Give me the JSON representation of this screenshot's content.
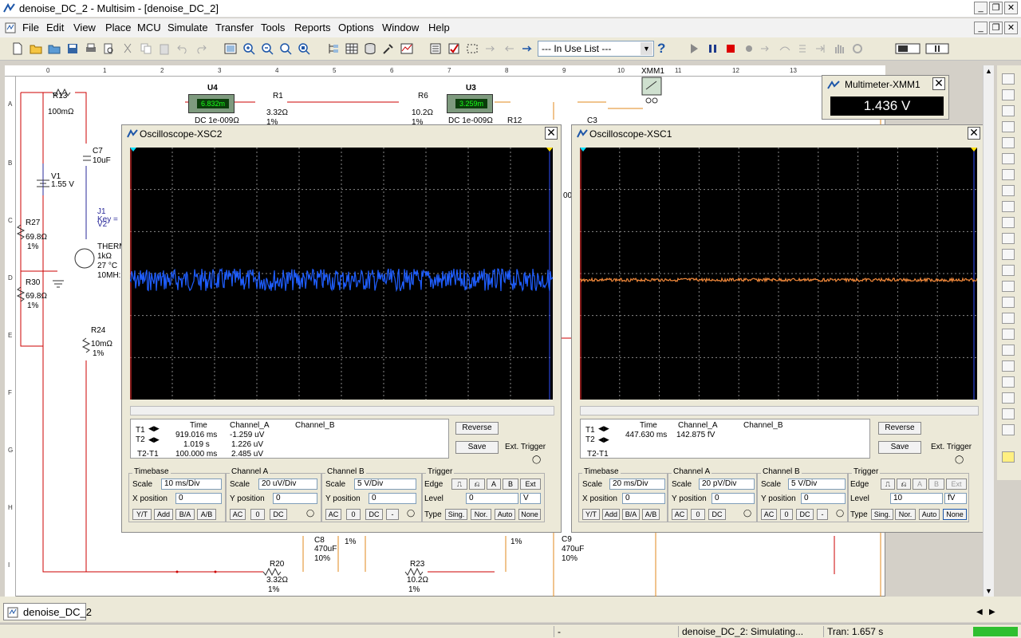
{
  "window": {
    "title": "denoise_DC_2 - Multisim - [denoise_DC_2]"
  },
  "menu": [
    "File",
    "Edit",
    "View",
    "Place",
    "MCU",
    "Simulate",
    "Transfer",
    "Tools",
    "Reports",
    "Options",
    "Window",
    "Help"
  ],
  "toolbar": {
    "in_use_list": "--- In Use List ---",
    "help": "?"
  },
  "ruler": {
    "top": [
      "0",
      "1",
      "2",
      "3",
      "4",
      "5",
      "6",
      "7",
      "8",
      "9",
      "10",
      "11",
      "12",
      "13"
    ],
    "left": [
      "A",
      "B",
      "C",
      "D",
      "E",
      "F",
      "G",
      "H",
      "I"
    ]
  },
  "schematic": {
    "R13": "R13",
    "R13v": "100mΩ",
    "U4": "U4",
    "U4_disp": "6.832m",
    "U4_mode": "DC  1e-009Ω",
    "R1": "R1",
    "R1v": "3.32Ω",
    "R1t": "1%",
    "R6": "R6",
    "R6v": "10.2Ω",
    "R6t": "1%",
    "U3": "U3",
    "U3_disp": "3.259m",
    "U3_mode": "DC  1e-009Ω",
    "R12": "R12",
    "C3": "C3",
    "C7": "C7",
    "C7v": "10uF",
    "V1": "V1",
    "V1v": "1.55 V",
    "J1": "J1",
    "J1k": "Key =",
    "J1v": "V2",
    "R27": "R27",
    "R27v": "69.8Ω",
    "R27t": "1%",
    "THERM": "THERM",
    "THv": "1kΩ",
    "THt": "27 °C",
    "THf": "10MH:",
    "R30": "R30",
    "R30v": "69.8Ω",
    "R30t": "1%",
    "R24": "R24",
    "R24v": "10mΩ",
    "R24t": "1%",
    "C8": "C8",
    "C8v": "470uF",
    "C8t": "10%",
    "R20": "R20",
    "R20v": "3.32Ω",
    "R20t": "1%",
    "R23": "R23",
    "R23v": "10.2Ω",
    "R23t": "1%",
    "C9": "C9",
    "C9v": "470uF",
    "C9t": "10%",
    "pct1": "1%",
    "pct2": "1%",
    "XMM1": "XMM1",
    "frag00": "00"
  },
  "multimeter": {
    "title": "Multimeter-XMM1",
    "value": "1.436 V"
  },
  "scope1": {
    "title": "Oscilloscope-XSC2",
    "trace_color": "#1f5eff",
    "readout": {
      "headers": [
        "Time",
        "Channel_A",
        "Channel_B"
      ],
      "t1": {
        "label": "T1",
        "time": "919.016 ms",
        "a": "-1.259 uV",
        "b": ""
      },
      "t2": {
        "label": "T2",
        "time": "1.019 s",
        "a": "1.226 uV",
        "b": ""
      },
      "t21": {
        "label": "T2-T1",
        "time": "100.000 ms",
        "a": "2.485 uV",
        "b": ""
      }
    },
    "buttons": {
      "reverse": "Reverse",
      "save": "Save",
      "ext_trigger": "Ext. Trigger"
    },
    "timebase": {
      "title": "Timebase",
      "scale_label": "Scale",
      "scale": "10 ms/Div",
      "xpos_label": "X position",
      "xpos": "0",
      "modes": [
        "Y/T",
        "Add",
        "B/A",
        "A/B"
      ]
    },
    "chA": {
      "title": "Channel A",
      "scale_label": "Scale",
      "scale": "20 uV/Div",
      "ypos_label": "Y position",
      "ypos": "0",
      "coupling": [
        "AC",
        "0",
        "DC"
      ]
    },
    "chB": {
      "title": "Channel B",
      "scale_label": "Scale",
      "scale": "5  V/Div",
      "ypos_label": "Y position",
      "ypos": "0",
      "coupling": [
        "AC",
        "0",
        "DC",
        "-"
      ]
    },
    "trigger": {
      "title": "Trigger",
      "edge_label": "Edge",
      "edge_buttons": [
        "A",
        "B",
        "Ext"
      ],
      "level_label": "Level",
      "level": "0",
      "level_unit": "V",
      "type_label": "Type",
      "types": [
        "Sing.",
        "Nor.",
        "Auto",
        "None"
      ]
    }
  },
  "scope2": {
    "title": "Oscilloscope-XSC1",
    "trace_color": "#f0883a",
    "readout": {
      "headers": [
        "Time",
        "Channel_A",
        "Channel_B"
      ],
      "t1": {
        "label": "T1",
        "time": "447.630 ms",
        "a": "142.875 fV",
        "b": ""
      },
      "t2": {
        "label": "T2",
        "time": "",
        "a": "",
        "b": ""
      },
      "t21": {
        "label": "T2-T1",
        "time": "",
        "a": "",
        "b": ""
      }
    },
    "buttons": {
      "reverse": "Reverse",
      "save": "Save",
      "ext_trigger": "Ext. Trigger"
    },
    "timebase": {
      "title": "Timebase",
      "scale_label": "Scale",
      "scale": "20 ms/Div",
      "xpos_label": "X position",
      "xpos": "0",
      "modes": [
        "Y/T",
        "Add",
        "B/A",
        "A/B"
      ]
    },
    "chA": {
      "title": "Channel A",
      "scale_label": "Scale",
      "scale": "20 pV/Div",
      "ypos_label": "Y position",
      "ypos": "0",
      "coupling": [
        "AC",
        "0",
        "DC"
      ]
    },
    "chB": {
      "title": "Channel B",
      "scale_label": "Scale",
      "scale": "5  V/Div",
      "ypos_label": "Y position",
      "ypos": "0",
      "coupling": [
        "AC",
        "0",
        "DC",
        "-"
      ]
    },
    "trigger": {
      "title": "Trigger",
      "edge_label": "Edge",
      "edge_buttons": [
        "A",
        "B",
        "Ext"
      ],
      "level_label": "Level",
      "level": "10",
      "level_unit": "fV",
      "type_label": "Type",
      "types": [
        "Sing.",
        "Nor.",
        "Auto",
        "None"
      ]
    }
  },
  "tabs": {
    "active": "denoise_DC_2"
  },
  "status": {
    "left": "-",
    "sim": "denoise_DC_2: Simulating...",
    "tran": "Tran: 1.657 s"
  }
}
